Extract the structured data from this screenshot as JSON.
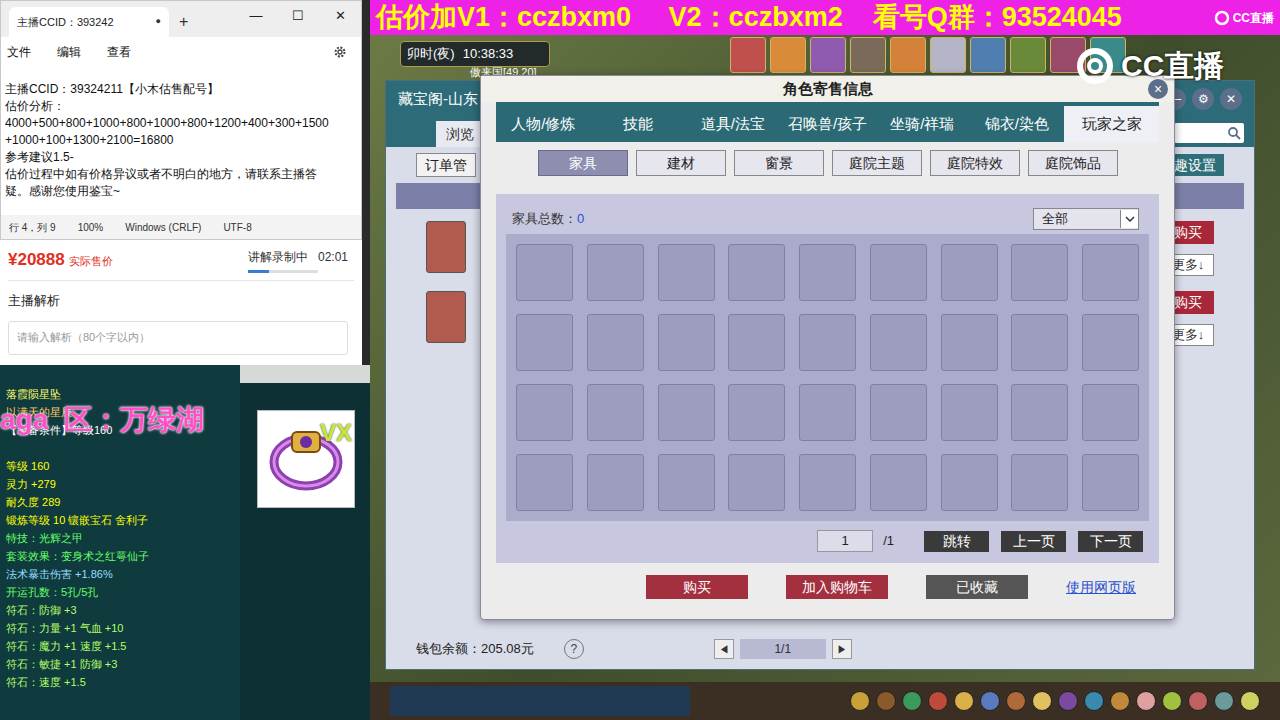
{
  "banner": {
    "text": "估价加V1：cczbxm0     V2：cczbxm2    看号Q群：93524045",
    "logo": "CC直播"
  },
  "notepad": {
    "tab_title": "主播CCID：393242",
    "tab_dot": "●",
    "new_tab": "+",
    "controls": [
      "—",
      "☐",
      "✕"
    ],
    "menu": [
      "文件",
      "编辑",
      "查看"
    ],
    "lines": [
      "主播CCID：39324211【小木估售配号】",
      "估价分析：",
      "4000+500+800+1000+800+1000+800+1200+400+300+1500",
      "+1000+100+1300+2100=16800",
      "参考建议1.5-",
      "估价过程中如有价格异议或者不明白的地方，请联系主播答",
      "疑。感谢您使用鉴宝~"
    ],
    "status": [
      "行 4，列 9",
      "100%",
      "Windows (CRLF)",
      "UTF-8"
    ]
  },
  "sale": {
    "price": "¥20888",
    "price_label": "实际售价",
    "recording": "讲解录制中",
    "time": "02:01",
    "level": 0.3,
    "analysis_title": "主播解析",
    "placeholder": "请输入解析（80个字以内）"
  },
  "item": {
    "overlay": "aga  区：万绿湖",
    "badge": "VX",
    "lines": [
      {
        "text": "落霞陨星坠",
        "color": "#ffff66"
      },
      {
        "text": "以满天的星辰",
        "color": "#ffcc66"
      },
      {
        "text": "【装备条件】等级160",
        "color": "#ffffff"
      },
      {
        "text": "",
        "color": "#ffffff"
      },
      {
        "text": "等级 160",
        "color": "#ffff00"
      },
      {
        "text": "灵力 +279",
        "color": "#ffff00"
      },
      {
        "text": "耐久度 289",
        "color": "#ffff00"
      },
      {
        "text": "锻炼等级 10 镶嵌宝石 舍利子",
        "color": "#ffff00"
      },
      {
        "text": "特技：光辉之甲",
        "color": "#66ff66"
      },
      {
        "text": "套装效果：变身术之红萼仙子",
        "color": "#66ff66"
      },
      {
        "text": "法术暴击伤害 +1.86%",
        "color": "#99ddff"
      },
      {
        "text": "开运孔数：5孔/5孔",
        "color": "#66ff66"
      },
      {
        "text": "符石：防御 +3",
        "color": "#b3ff66"
      },
      {
        "text": "符石：力量 +1 气血 +10",
        "color": "#b3ff66"
      },
      {
        "text": "符石：魔力 +1 速度 +1.5",
        "color": "#b3ff66"
      },
      {
        "text": "符石：敏捷 +1 防御 +3",
        "color": "#b3ff66"
      },
      {
        "text": "符石：速度 +1.5",
        "color": "#b3ff66"
      }
    ]
  },
  "game": {
    "time_label": "卯时(夜)",
    "clock": "10:38:33",
    "location": "傲来国[49,20]",
    "watermark": "CC直播"
  },
  "market": {
    "title": "藏宝阁-山东",
    "controls": [
      "—",
      "⚙",
      "✕"
    ],
    "tab": "浏览",
    "order": "订单管",
    "interest": "兴趣设置",
    "rows": [
      {
        "buy": "购买",
        "more": "更多↓"
      },
      {
        "buy": "购买",
        "more": "更多↓"
      }
    ],
    "wallet": "钱包余额：205.08元",
    "help": "?",
    "prev": "◀",
    "page": "1/1",
    "next": "▶"
  },
  "dialog": {
    "title": "角色寄售信息",
    "close": "×",
    "tabs": [
      {
        "label": "人物/修炼",
        "selected": false
      },
      {
        "label": "技能",
        "selected": false
      },
      {
        "label": "道具/法宝",
        "selected": false
      },
      {
        "label": "召唤兽/孩子",
        "selected": false
      },
      {
        "label": "坐骑/祥瑞",
        "selected": false
      },
      {
        "label": "锦衣/染色",
        "selected": false
      },
      {
        "label": "玩家之家",
        "selected": true
      }
    ],
    "subtabs": [
      {
        "label": "家具",
        "selected": true
      },
      {
        "label": "建材",
        "selected": false
      },
      {
        "label": "窗景",
        "selected": false
      },
      {
        "label": "庭院主题",
        "selected": false
      },
      {
        "label": "庭院特效",
        "selected": false
      },
      {
        "label": "庭院饰品",
        "selected": false
      }
    ],
    "count_label": "家具总数：",
    "count": "0",
    "filter": "全部",
    "page_input": "1",
    "page_total": "/1",
    "page_buttons": [
      "跳转",
      "上一页",
      "下一页"
    ],
    "actions": [
      "购买",
      "加入购物车",
      "已收藏"
    ],
    "web_link": "使用网页版"
  }
}
